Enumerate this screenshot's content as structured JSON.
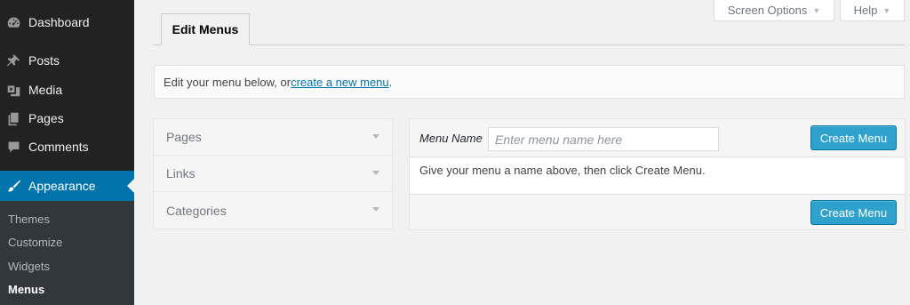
{
  "sidebar": {
    "items": [
      {
        "label": "Dashboard",
        "icon": "dashboard-icon"
      },
      {
        "label": "Posts",
        "icon": "pin-icon"
      },
      {
        "label": "Media",
        "icon": "media-icon"
      },
      {
        "label": "Pages",
        "icon": "pages-icon"
      },
      {
        "label": "Comments",
        "icon": "comment-icon"
      },
      {
        "label": "Appearance",
        "icon": "brush-icon"
      }
    ],
    "submenu": [
      "Themes",
      "Customize",
      "Widgets",
      "Menus"
    ]
  },
  "screen_meta": {
    "screen_options": "Screen Options",
    "help": "Help",
    "caret": "▼"
  },
  "tabs": {
    "edit_menus": "Edit Menus"
  },
  "notice": {
    "prefix": "Edit your menu below, or ",
    "link": "create a new menu",
    "suffix": "."
  },
  "accordion": {
    "sections": [
      "Pages",
      "Links",
      "Categories"
    ]
  },
  "menu_management": {
    "name_label": "Menu Name",
    "name_placeholder": "Enter menu name here",
    "body_text": "Give your menu a name above, then click Create Menu.",
    "create_button": "Create Menu"
  },
  "colors": {
    "sidebar_bg": "#222222",
    "submenu_bg": "#32373c",
    "current_menu": "#0073aa",
    "primary_button": "#2ea2cc",
    "link": "#0073aa",
    "page_bg": "#f1f1f1"
  }
}
